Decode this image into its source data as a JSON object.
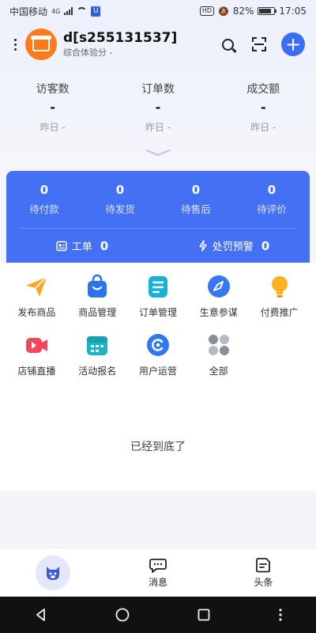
{
  "status_bar": {
    "carrier": "中国移动",
    "network_type": "4G",
    "hd_label": "HD",
    "battery": "82%",
    "time": "17:05"
  },
  "header": {
    "shop_name": "d[s255131537]",
    "experience_score": "综合体验分 -"
  },
  "stats": [
    {
      "label": "访客数",
      "value": "-",
      "sub": "昨日 -"
    },
    {
      "label": "订单数",
      "value": "-",
      "sub": "昨日 -"
    },
    {
      "label": "成交额",
      "value": "-",
      "sub": "昨日 -"
    }
  ],
  "orders": [
    {
      "count": "0",
      "label": "待付款"
    },
    {
      "count": "0",
      "label": "待发货"
    },
    {
      "count": "0",
      "label": "待售后"
    },
    {
      "count": "0",
      "label": "待评价"
    }
  ],
  "order_footer": {
    "ticket_label": "工单",
    "ticket_count": "0",
    "penalty_label": "处罚预警",
    "penalty_count": "0"
  },
  "tools": [
    {
      "label": "发布商品",
      "icon": "paper-plane-icon",
      "color": "#ffa51f"
    },
    {
      "label": "商品管理",
      "icon": "shopping-bag-icon",
      "color": "#2c73f0"
    },
    {
      "label": "订单管理",
      "icon": "document-icon",
      "color": "#17b3d6"
    },
    {
      "label": "生意参谋",
      "icon": "compass-icon",
      "color": "#3478f6"
    },
    {
      "label": "付费推广",
      "icon": "lightbulb-icon",
      "color": "#ffb020"
    },
    {
      "label": "店铺直播",
      "icon": "video-camera-icon",
      "color": "#f4445e"
    },
    {
      "label": "活动报名",
      "icon": "calendar-icon",
      "color": "#18b4c8"
    },
    {
      "label": "用户运营",
      "icon": "user-ops-icon",
      "color": "#2f78f0"
    },
    {
      "label": "全部",
      "icon": "all-apps-icon",
      "color": "#8a8f99"
    }
  ],
  "end_text": "已经到底了",
  "bottom_nav": {
    "home_label": "",
    "messages_label": "消息",
    "headlines_label": "头条"
  },
  "colors": {
    "brand_blue": "#4470f4",
    "avatar_orange": "#ff7a1a"
  }
}
